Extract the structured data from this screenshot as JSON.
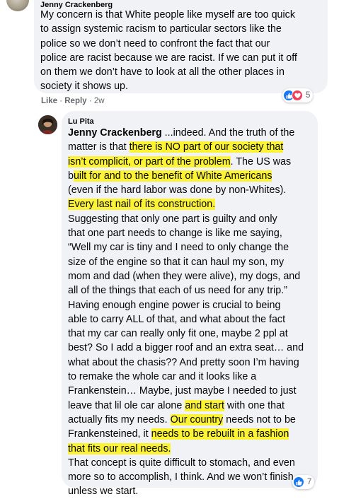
{
  "comments": [
    {
      "author": "Jenny Crackenberg",
      "lines": [
        "My concern is that White people like myself are too quick",
        "to assign systemic racism to particular sectors like the",
        "police so we don’t need to confront the fact that our",
        "police are racist because we are racist. If we can put it off",
        "on them we don’t have to look at all the other places in",
        "society it shows up."
      ],
      "actions": {
        "like": "Like",
        "separator": " · ",
        "reply": "Reply",
        "time": "2w"
      },
      "reactions": {
        "icons": [
          "like-icon",
          "love-icon"
        ],
        "count": "5"
      }
    },
    {
      "author": "Lu Pita",
      "mention": "Jenny Crackenberg",
      "segments": [
        [
          " ...indeed. And the truth of the"
        ],
        [
          "matter is that ",
          "there is NO part of our society that"
        ],
        [
          "isn’t complicit, or part of the problem",
          ". The US was"
        ],
        [
          "b",
          "uilt for and to the benefit of White Americans"
        ],
        [
          "(even if the hard labor was done by non-Whites)."
        ],
        [
          "Every last nail of its construction."
        ],
        [
          "Suggesting that only one part is guilty and only"
        ],
        [
          "that one part needs to change is like me saying,"
        ],
        [
          "“Well my car is tiny and I need to only change the"
        ],
        [
          "size of the engine so that it can haul my son, my"
        ],
        [
          "mom and dad (when they were alive), my dogs, and"
        ],
        [
          "all of the things that each of us need for any trip.”"
        ],
        [
          "Having enough engine power is crucial to being"
        ],
        [
          "able to carry ALL of that, and what about the fact"
        ],
        [
          "that my car can really only fit one, maybe 2 ppl at"
        ],
        [
          "best? So I add a bigger roof and an extra seat… and"
        ],
        [
          "what about the chasis?? And pretty soon I’m having"
        ],
        [
          "to remake the whole car and it looks like a"
        ],
        [
          "Frankenstein… Maybe, just maybe I needed to just"
        ],
        [
          "leave that lil ole car alone ",
          "and start",
          " with one that"
        ],
        [
          "actually fits my needs. ",
          "Our country",
          " needs not to be"
        ],
        [
          "Frankensteined, it ",
          "needs to be rebuilt in a fashion"
        ],
        [
          "that fits our real needs."
        ],
        [
          "That concept is quite difficult to stomach, and even"
        ],
        [
          "more so to accomplish, I think. And we won’t finish"
        ],
        [
          "unless we start."
        ]
      ],
      "reactions": {
        "icons": [
          "like-icon"
        ],
        "count": "7"
      }
    }
  ],
  "colors": {
    "bubble": "#f0f2f5",
    "highlight": "#fcf336",
    "like": "#1877f2",
    "love": "#f33e58",
    "meta_text": "#65676b"
  }
}
